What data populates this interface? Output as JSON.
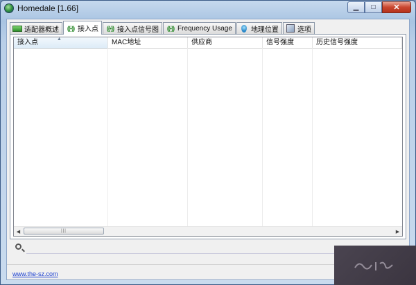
{
  "window": {
    "title": "Homedale [1.66]",
    "controls": {
      "minimize": "▁",
      "maximize": "□",
      "close": "✕"
    }
  },
  "tabs": [
    {
      "label": "适配器概述",
      "icon": "network-adapter-icon",
      "active": false
    },
    {
      "label": "接入点",
      "icon": "wifi-signal-icon",
      "active": true
    },
    {
      "label": "接入点信号图",
      "icon": "wifi-signal-icon",
      "active": false
    },
    {
      "label": "Frequency Usage",
      "icon": "wifi-signal-icon",
      "active": false
    },
    {
      "label": "地理位置",
      "icon": "location-pin-icon",
      "active": false
    },
    {
      "label": "选项",
      "icon": "options-icon",
      "active": false
    }
  ],
  "list": {
    "columns": [
      "接入点",
      "MAC地址",
      "供应商",
      "信号强度",
      "历史信号强度"
    ],
    "sorted_column": "接入点",
    "rows": []
  },
  "search": {
    "value": "",
    "placeholder": ""
  },
  "footer": {
    "link": "www.the-sz.com"
  },
  "colors": {
    "accent": "#1a3fd0",
    "title_bar": "#a9c4e2",
    "close_button": "#c9462f"
  }
}
